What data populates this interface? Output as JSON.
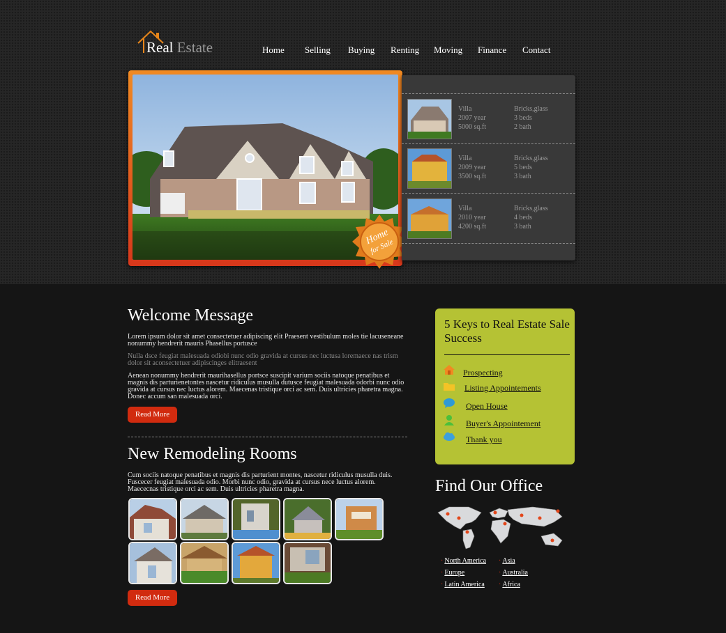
{
  "brand": {
    "name_part1": "Real",
    "name_part2": "Estate"
  },
  "nav": [
    "Home",
    "Selling",
    "Buying",
    "Renting",
    "Moving",
    "Finance",
    "Contact"
  ],
  "hero": {
    "badge_line1": "Home",
    "badge_line2": "for Sale"
  },
  "listings": [
    {
      "type": "Villa",
      "year": "2007 year",
      "area": "5000 sq.ft",
      "material": "Bricks,glass",
      "beds": "3 beds",
      "baths": "2 bath"
    },
    {
      "type": "Villa",
      "year": "2009 year",
      "area": "3500 sq.ft",
      "material": "Bricks,glass",
      "beds": "5 beds",
      "baths": "3 bath"
    },
    {
      "type": "Villa",
      "year": "2010 year",
      "area": "4200 sq.ft",
      "material": "Bricks,glass",
      "beds": "4 beds",
      "baths": "3 bath"
    }
  ],
  "welcome": {
    "title": "Welcome Message",
    "p1": "Lorem ipsum dolor sit amet consectetuer adipiscing elit Praesent vestibulum moles tie lacuseneane nonummy hendrerit mauris Phasellus portusce",
    "p2": "Nulla dsce feugiat malesuada odiobi nunc odio gravida at cursus nec luctusa loremaece nas trism dolor sit aconsectetuer adipiscinges elitraesent",
    "p3": "Aenean nonummy hendrerit maurihasellus portsce suscipit varium sociis natoque penatibus et magnis dis parturienetontes nascetur ridiculus musulla dutusce feugiat malesuada odorbi nunc odio gravida at cursus nec luctus alorem. Maecenas tristique orci ac sem. Duis ultricies pharetra magna. Donec accum san malesuada orci.",
    "button": "Read More"
  },
  "remodel": {
    "title": "New Remodeling Rooms",
    "p1": "Cum sociis natoque penatibus et magnis dis parturient montes, nascetur ridiculus musulla duis. Fuscecer feugiat malesuada odio. Morbi nunc odio, gravida at cursus nece luctus alorem. Maececnas tristique orci ac sem. Duis ultricies pharetra magna.",
    "button": "Read More"
  },
  "keys": {
    "title": "5 Keys to Real Estate Sale Success",
    "items": [
      {
        "label": "Prospecting",
        "icon": "house-icon"
      },
      {
        "label": "Listing Appointements",
        "icon": "folder-icon"
      },
      {
        "label": "Open House",
        "icon": "chat-bubble-icon"
      },
      {
        "label": "Buyer's Appointement",
        "icon": "person-icon"
      },
      {
        "label": "Thank you",
        "icon": "cloud-icon"
      }
    ]
  },
  "office": {
    "title": "Find Our Office",
    "regions_col1": [
      "North America",
      "Europe",
      "Latin America"
    ],
    "regions_col2": [
      "Asia",
      "Australia",
      "Africa"
    ]
  },
  "colors": {
    "accent": "#d12b0f",
    "orange": "#f08a22",
    "lime": "#b5c234",
    "panel": "#393939"
  }
}
